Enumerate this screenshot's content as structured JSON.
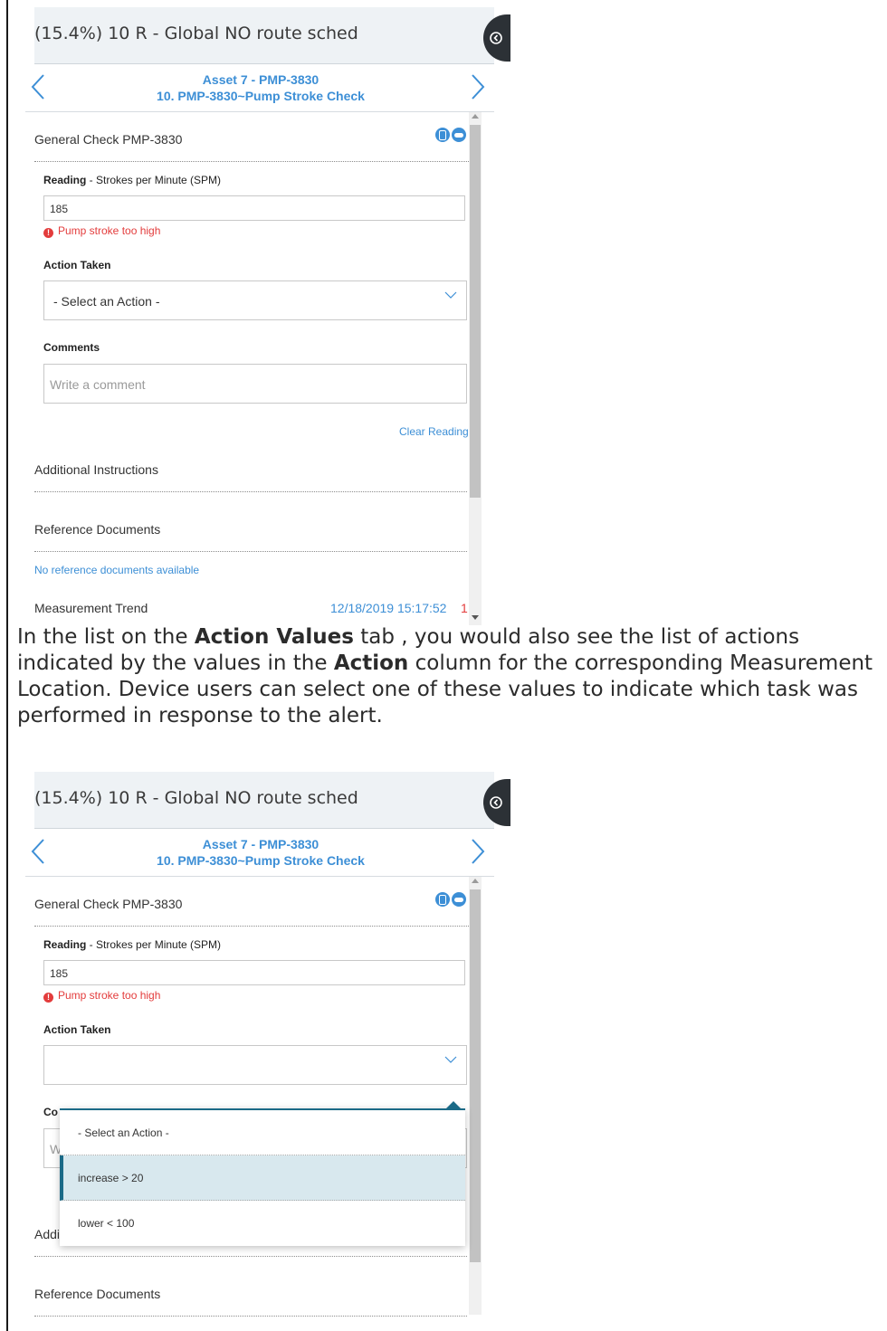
{
  "screen1": {
    "title": "(15.4%) 10 R - Global NO route sched",
    "nav": {
      "line1": "Asset 7 - PMP-3830",
      "line2": "10. PMP-3830~Pump Stroke Check"
    },
    "section_title": "General Check PMP-3830",
    "reading_label_main": "Reading",
    "reading_label_rest": " - Strokes per Minute (SPM)",
    "reading_value": "185",
    "error_text": "Pump stroke too high",
    "action_label": "Action Taken",
    "action_selected": "- Select an Action -",
    "comments_label": "Comments",
    "comments_placeholder": "Write a comment",
    "clear_reading": "Clear Reading",
    "additional_instructions": "Additional Instructions",
    "reference_documents": "Reference Documents",
    "no_reference": "No reference documents available",
    "measurement_trend": "Measurement Trend",
    "trend_date": "12/18/2019 15:17:52",
    "trend_value": "1"
  },
  "paragraph": {
    "p1": "In the list on the ",
    "b1": "Action Values",
    "p2": " tab , you would also see the list of actions indicated by the values in the ",
    "b2": "Action",
    "p3": " column for the corresponding Measurement Location. Device users can select one of these values to indicate which task was performed in response to the alert."
  },
  "screen2": {
    "title": "(15.4%) 10 R - Global NO route sched",
    "nav": {
      "line1": "Asset 7 - PMP-3830",
      "line2": "10. PMP-3830~Pump Stroke Check"
    },
    "section_title": "General Check PMP-3830",
    "reading_label_main": "Reading",
    "reading_label_rest": " - Strokes per Minute (SPM)",
    "reading_value": "185",
    "error_text": "Pump stroke too high",
    "action_label": "Action Taken",
    "comments_partial": "Co",
    "comments_input_partial": "W",
    "additional_partial": "Addi",
    "reference_documents": "Reference Documents",
    "dropdown_options": [
      "- Select an Action -",
      "increase > 20",
      "lower < 100"
    ],
    "selected_option_index": 1
  },
  "colors": {
    "accent": "#3d8fd6",
    "error": "#e33c3c",
    "selected_bg": "#d8e8ee",
    "selected_bar": "#1b6a87"
  }
}
